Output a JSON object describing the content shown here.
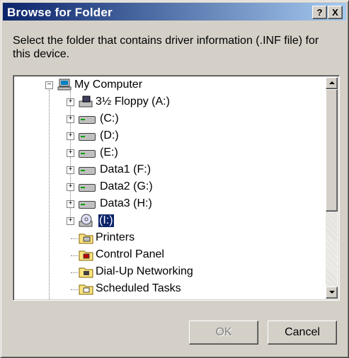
{
  "window": {
    "title": "Browse for Folder",
    "help_glyph": "?",
    "close_glyph": "X"
  },
  "prompt": "Select the folder that contains driver information (.INF file) for this device.",
  "tree": {
    "root": {
      "label": "My Computer",
      "icon": "computer-icon",
      "expander": "−"
    },
    "items": [
      {
        "label": "3½ Floppy (A:)",
        "icon": "floppy-drive-icon",
        "expander": "+"
      },
      {
        "label": "(C:)",
        "icon": "hard-drive-icon",
        "expander": "+"
      },
      {
        "label": "(D:)",
        "icon": "hard-drive-icon",
        "expander": "+"
      },
      {
        "label": "(E:)",
        "icon": "hard-drive-icon",
        "expander": "+"
      },
      {
        "label": "Data1 (F:)",
        "icon": "hard-drive-icon",
        "expander": "+"
      },
      {
        "label": "Data2 (G:)",
        "icon": "hard-drive-icon",
        "expander": "+"
      },
      {
        "label": "Data3 (H:)",
        "icon": "hard-drive-icon",
        "expander": "+"
      },
      {
        "label": "(I:)",
        "icon": "cd-drive-icon",
        "expander": "+",
        "selected": true
      },
      {
        "label": "Printers",
        "icon": "printers-folder-icon"
      },
      {
        "label": "Control Panel",
        "icon": "control-panel-folder-icon"
      },
      {
        "label": "Dial-Up Networking",
        "icon": "dialup-folder-icon"
      },
      {
        "label": "Scheduled Tasks",
        "icon": "scheduled-tasks-folder-icon"
      }
    ]
  },
  "buttons": {
    "ok": "OK",
    "cancel": "Cancel"
  },
  "colors": {
    "titlebar_start": "#0a246a",
    "titlebar_end": "#a6caf0",
    "face": "#d4d0c8",
    "selection": "#0a246a"
  }
}
